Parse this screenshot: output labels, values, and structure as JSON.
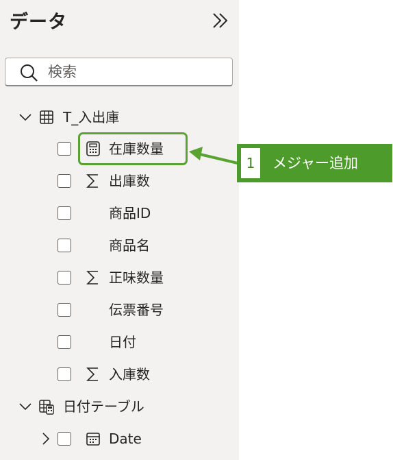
{
  "pane": {
    "title": "データ",
    "collapse_icon": "double-chevron-right-icon",
    "search": {
      "placeholder": "検索",
      "value": ""
    }
  },
  "tables": [
    {
      "name": "T_入出庫",
      "expanded": true,
      "icon": "table-icon",
      "fields": [
        {
          "label": "在庫数量",
          "icon": "measure-calculator-icon",
          "checked": false
        },
        {
          "label": "出庫数",
          "icon": "sigma-icon",
          "checked": false
        },
        {
          "label": "商品ID",
          "icon": "",
          "checked": false
        },
        {
          "label": "商品名",
          "icon": "",
          "checked": false
        },
        {
          "label": "正味数量",
          "icon": "sigma-icon",
          "checked": false
        },
        {
          "label": "伝票番号",
          "icon": "",
          "checked": false
        },
        {
          "label": "日付",
          "icon": "",
          "checked": false
        },
        {
          "label": "入庫数",
          "icon": "sigma-icon",
          "checked": false
        }
      ]
    },
    {
      "name": "日付テーブル",
      "expanded": true,
      "icon": "calculated-table-icon",
      "fields": [
        {
          "label": "Date",
          "icon": "calendar-icon",
          "checked": false,
          "collapsed": true
        }
      ]
    }
  ],
  "annotation": {
    "number": "1",
    "text": "メジャー追加",
    "color": "#4d9b2b"
  }
}
